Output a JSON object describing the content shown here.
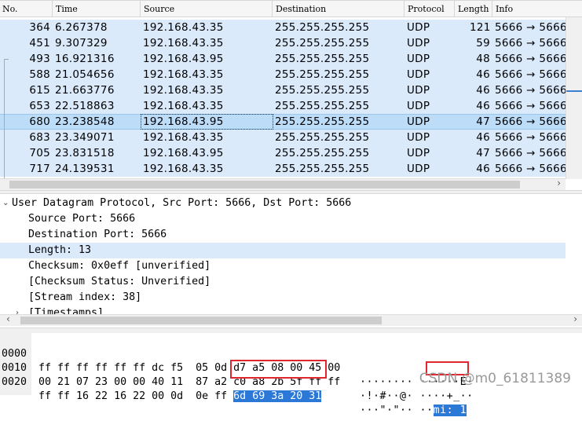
{
  "packet_list": {
    "columns": [
      "No.",
      "Time",
      "Source",
      "Destination",
      "Protocol",
      "Length",
      "Info"
    ],
    "rows": [
      {
        "no": "364",
        "time": "6.267378",
        "src": "192.168.43.35",
        "dst": "255.255.255.255",
        "proto": "UDP",
        "len": "121",
        "info": "5666 → 5666"
      },
      {
        "no": "451",
        "time": "9.307329",
        "src": "192.168.43.35",
        "dst": "255.255.255.255",
        "proto": "UDP",
        "len": "59",
        "info": "5666 → 5666"
      },
      {
        "no": "493",
        "time": "16.921316",
        "src": "192.168.43.95",
        "dst": "255.255.255.255",
        "proto": "UDP",
        "len": "48",
        "info": "5666 → 5666"
      },
      {
        "no": "588",
        "time": "21.054656",
        "src": "192.168.43.35",
        "dst": "255.255.255.255",
        "proto": "UDP",
        "len": "46",
        "info": "5666 → 5666"
      },
      {
        "no": "615",
        "time": "21.663776",
        "src": "192.168.43.35",
        "dst": "255.255.255.255",
        "proto": "UDP",
        "len": "46",
        "info": "5666 → 5666"
      },
      {
        "no": "653",
        "time": "22.518863",
        "src": "192.168.43.35",
        "dst": "255.255.255.255",
        "proto": "UDP",
        "len": "46",
        "info": "5666 → 5666"
      },
      {
        "no": "680",
        "time": "23.238548",
        "src": "192.168.43.95",
        "dst": "255.255.255.255",
        "proto": "UDP",
        "len": "47",
        "info": "5666 → 5666"
      },
      {
        "no": "683",
        "time": "23.349071",
        "src": "192.168.43.35",
        "dst": "255.255.255.255",
        "proto": "UDP",
        "len": "46",
        "info": "5666 → 5666"
      },
      {
        "no": "705",
        "time": "23.831518",
        "src": "192.168.43.95",
        "dst": "255.255.255.255",
        "proto": "UDP",
        "len": "47",
        "info": "5666 → 5666"
      },
      {
        "no": "717",
        "time": "24.139531",
        "src": "192.168.43.35",
        "dst": "255.255.255.255",
        "proto": "UDP",
        "len": "46",
        "info": "5666 → 5666"
      }
    ],
    "selected_no": "680"
  },
  "details": {
    "header": "User Datagram Protocol, Src Port: 5666, Dst Port: 5666",
    "fields": [
      "Source Port: 5666",
      "Destination Port: 5666",
      "Length: 13",
      "Checksum: 0x0eff [unverified]",
      "[Checksum Status: Unverified]",
      "[Stream index: 38]",
      "[Timestamps]"
    ],
    "highlighted": "Length: 13"
  },
  "hex": {
    "rows": [
      {
        "offset": "0000",
        "bytes": "ff ff ff ff ff ff dc f5  05 0d d7 a5 08 00 45 00",
        "ascii": "········ ······E·"
      },
      {
        "offset": "0010",
        "bytes": "00 21 07 23 00 00 40 11  87 a2 c0 a8 2b 5f ff ff",
        "ascii": "·!·#··@· ····+_··"
      },
      {
        "offset": "0020",
        "bytes_plain": "ff ff 16 22 16 22 00 0d  0e ff ",
        "bytes_selected": "6d 69 3a 20 31",
        "ascii_plain": "···\"·\"·· ··",
        "ascii_selected": "mi: 1"
      }
    ]
  },
  "watermark": "CSDN @m0_61811389",
  "colors": {
    "row_bg": "#dbeafb",
    "selected_row": "#bcdcf8",
    "hex_highlight": "#2c78d6",
    "annotation_box": "#e0262e"
  }
}
